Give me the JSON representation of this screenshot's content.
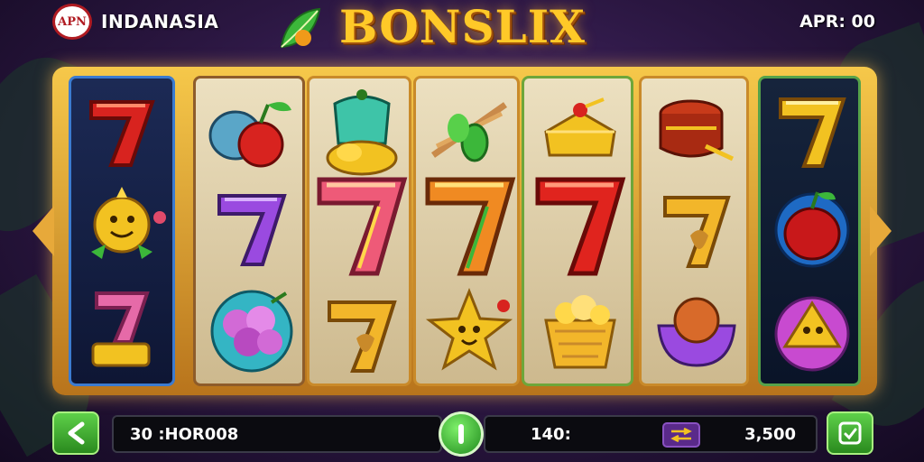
{
  "header": {
    "brand_logo_text": "APN",
    "brand_name": "INDANASIA",
    "title": "BONSLIX",
    "date_text": "APR: 00"
  },
  "footer": {
    "balance_text": "30 :HOR008",
    "bet_text": "140:",
    "win_text": "3,500"
  },
  "colors": {
    "accent_gold": "#ffc928",
    "button_green": "#3aa82a",
    "bet_chip_purple": "#5a2a8a"
  },
  "reels": [
    [
      "seven-red",
      "sun-face",
      "seven-pink-bar"
    ],
    [
      "fruit-bag",
      "seven-purple",
      "grapes"
    ],
    [
      "cake-coins",
      "seven-big-pink",
      "seven-gold"
    ],
    [
      "leaf-bundle",
      "seven-big-orange",
      "star-face"
    ],
    [
      "butter-dish",
      "seven-big-red",
      "gold-basket"
    ],
    [
      "drum",
      "seven-gold",
      "bowl-purple"
    ],
    [
      "seven-gold",
      "red-fruit",
      "cheese-wedge"
    ]
  ]
}
